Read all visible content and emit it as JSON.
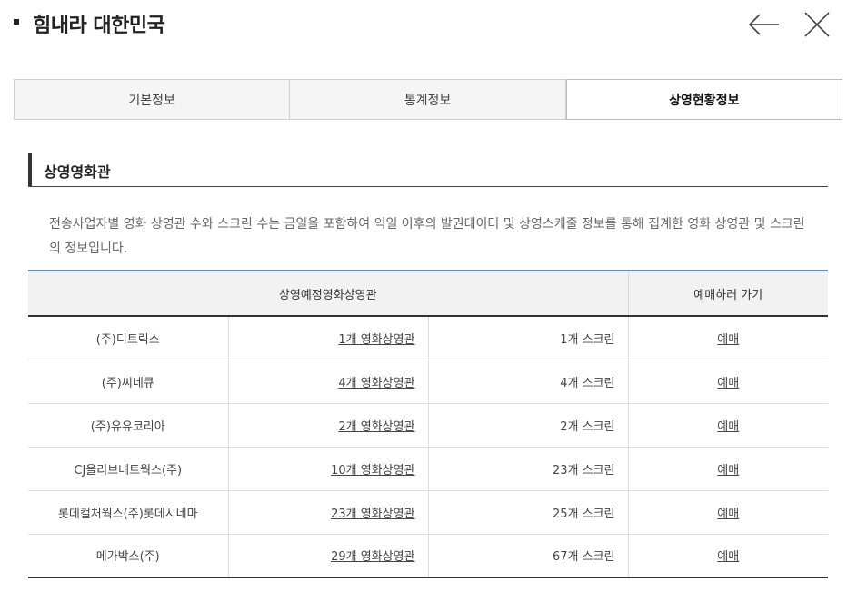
{
  "header": {
    "title": "힘내라 대한민국"
  },
  "tabs": [
    {
      "label": "기본정보",
      "active": false
    },
    {
      "label": "통계정보",
      "active": false
    },
    {
      "label": "상영현황정보",
      "active": true
    }
  ],
  "section": {
    "title": "상영영화관",
    "description": "전송사업자별 영화 상영관 수와 스크린 수는 금일을 포함하여 익일 이후의 발권데이터 및 상영스케줄 정보를 통해 집계한 영화 상영관 및 스크린의 정보입니다."
  },
  "table": {
    "headers": [
      "상영예정영화상영관",
      "예매하러 가기"
    ],
    "rows": [
      {
        "name": "(주)디트릭스",
        "theaters": "1개 영화상영관",
        "screens": "1개 스크린",
        "book": "예매"
      },
      {
        "name": "(주)씨네큐",
        "theaters": "4개 영화상영관",
        "screens": "4개 스크린",
        "book": "예매"
      },
      {
        "name": "(주)유유코리아",
        "theaters": "2개 영화상영관",
        "screens": "2개 스크린",
        "book": "예매"
      },
      {
        "name": "CJ올리브네트웍스(주)",
        "theaters": "10개 영화상영관",
        "screens": "23개 스크린",
        "book": "예매"
      },
      {
        "name": "롯데컬처웍스(주)롯데시네마",
        "theaters": "23개 영화상영관",
        "screens": "25개 스크린",
        "book": "예매"
      },
      {
        "name": "메가박스(주)",
        "theaters": "29개 영화상영관",
        "screens": "67개 스크린",
        "book": "예매"
      }
    ]
  },
  "icons": {
    "back": "arrow-left-icon",
    "close": "close-icon"
  }
}
